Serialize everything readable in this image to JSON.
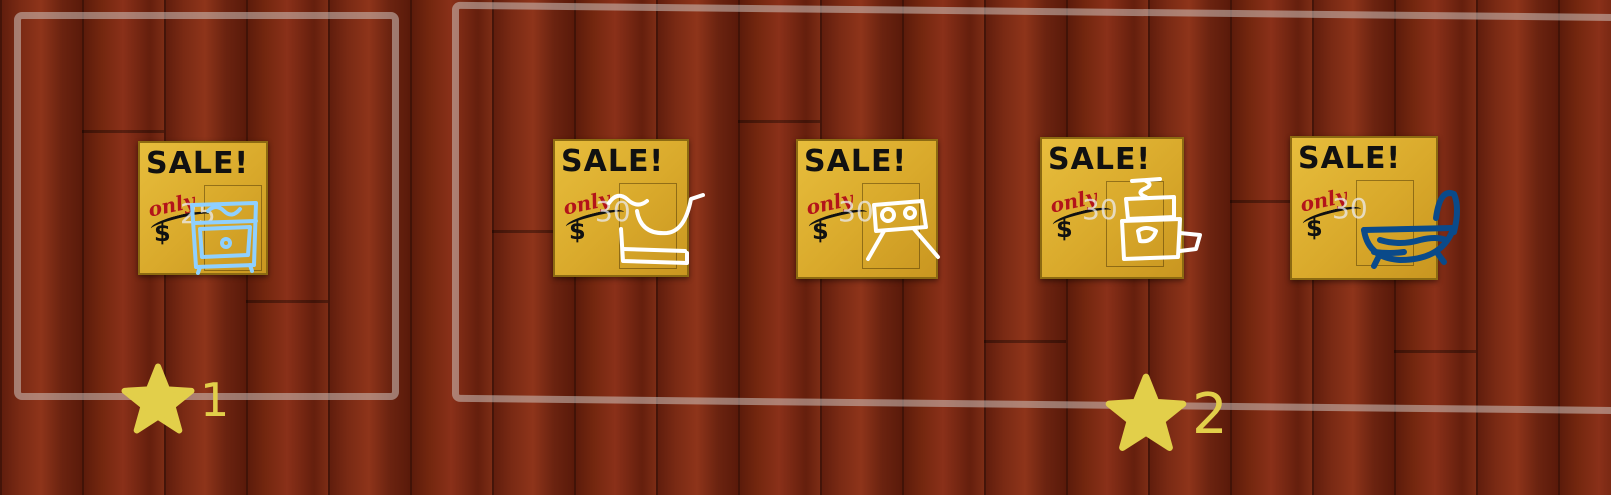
{
  "sign_heading": "SALE!",
  "sign_only": "only",
  "sign_currency": "$",
  "colors": {
    "star": "#e2cf4a",
    "frame": "#cdc3be",
    "sign": "#e0b234"
  },
  "groups": [
    {
      "stars": "1"
    },
    {
      "stars": "2"
    }
  ],
  "items": [
    {
      "price": "25",
      "icon": "washing-machine-icon",
      "ink": "#8fd0ff"
    },
    {
      "price": "30",
      "icon": "sink-icon",
      "ink": "#ffffff"
    },
    {
      "price": "30",
      "icon": "table-icon",
      "ink": "#ffffff"
    },
    {
      "price": "30",
      "icon": "toilet-icon",
      "ink": "#ffffff"
    },
    {
      "price": "30",
      "icon": "bathtub-icon",
      "ink": "#0a4a8a"
    }
  ]
}
